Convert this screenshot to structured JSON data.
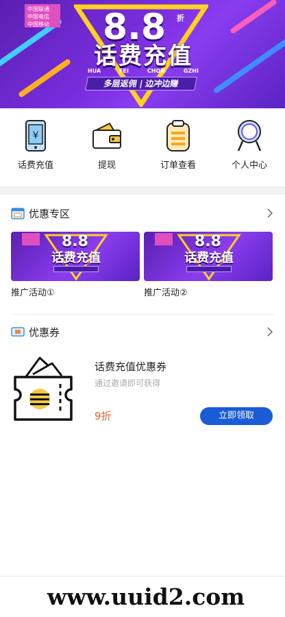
{
  "banner": {
    "carriers": [
      "中国联通",
      "中国电信",
      "中国移动"
    ],
    "number": "8.8",
    "discount_unit": "折",
    "title": "话费充值",
    "pinyin": [
      "HUA",
      "FEI",
      "CHON",
      "GZHI"
    ],
    "slogan": "多层返佣 | 边冲边赚"
  },
  "nav": {
    "items": [
      {
        "label": "话费充值",
        "icon": "phone-yuan-icon"
      },
      {
        "label": "提现",
        "icon": "wallet-icon"
      },
      {
        "label": "订单查看",
        "icon": "clipboard-icon"
      },
      {
        "label": "个人中心",
        "icon": "user-icon"
      }
    ]
  },
  "promo_section": {
    "title": "优惠专区",
    "cards": [
      {
        "label": "推广活动①",
        "number": "8.8",
        "title": "话费充值"
      },
      {
        "label": "推广活动②",
        "number": "8.8",
        "title": "话费充值"
      }
    ]
  },
  "coupon_section": {
    "title": "优惠券",
    "coupon": {
      "title": "话费充值优惠券",
      "subtitle": "通过邀请即可获得",
      "price": "9折",
      "button": "立即领取"
    }
  },
  "watermark": "www.uuid2.com",
  "colors": {
    "banner_purple": "#7a2ee0",
    "accent_blue": "#1a5bd6",
    "price_orange": "#e3632a",
    "icon_yellow": "#f6c842"
  }
}
